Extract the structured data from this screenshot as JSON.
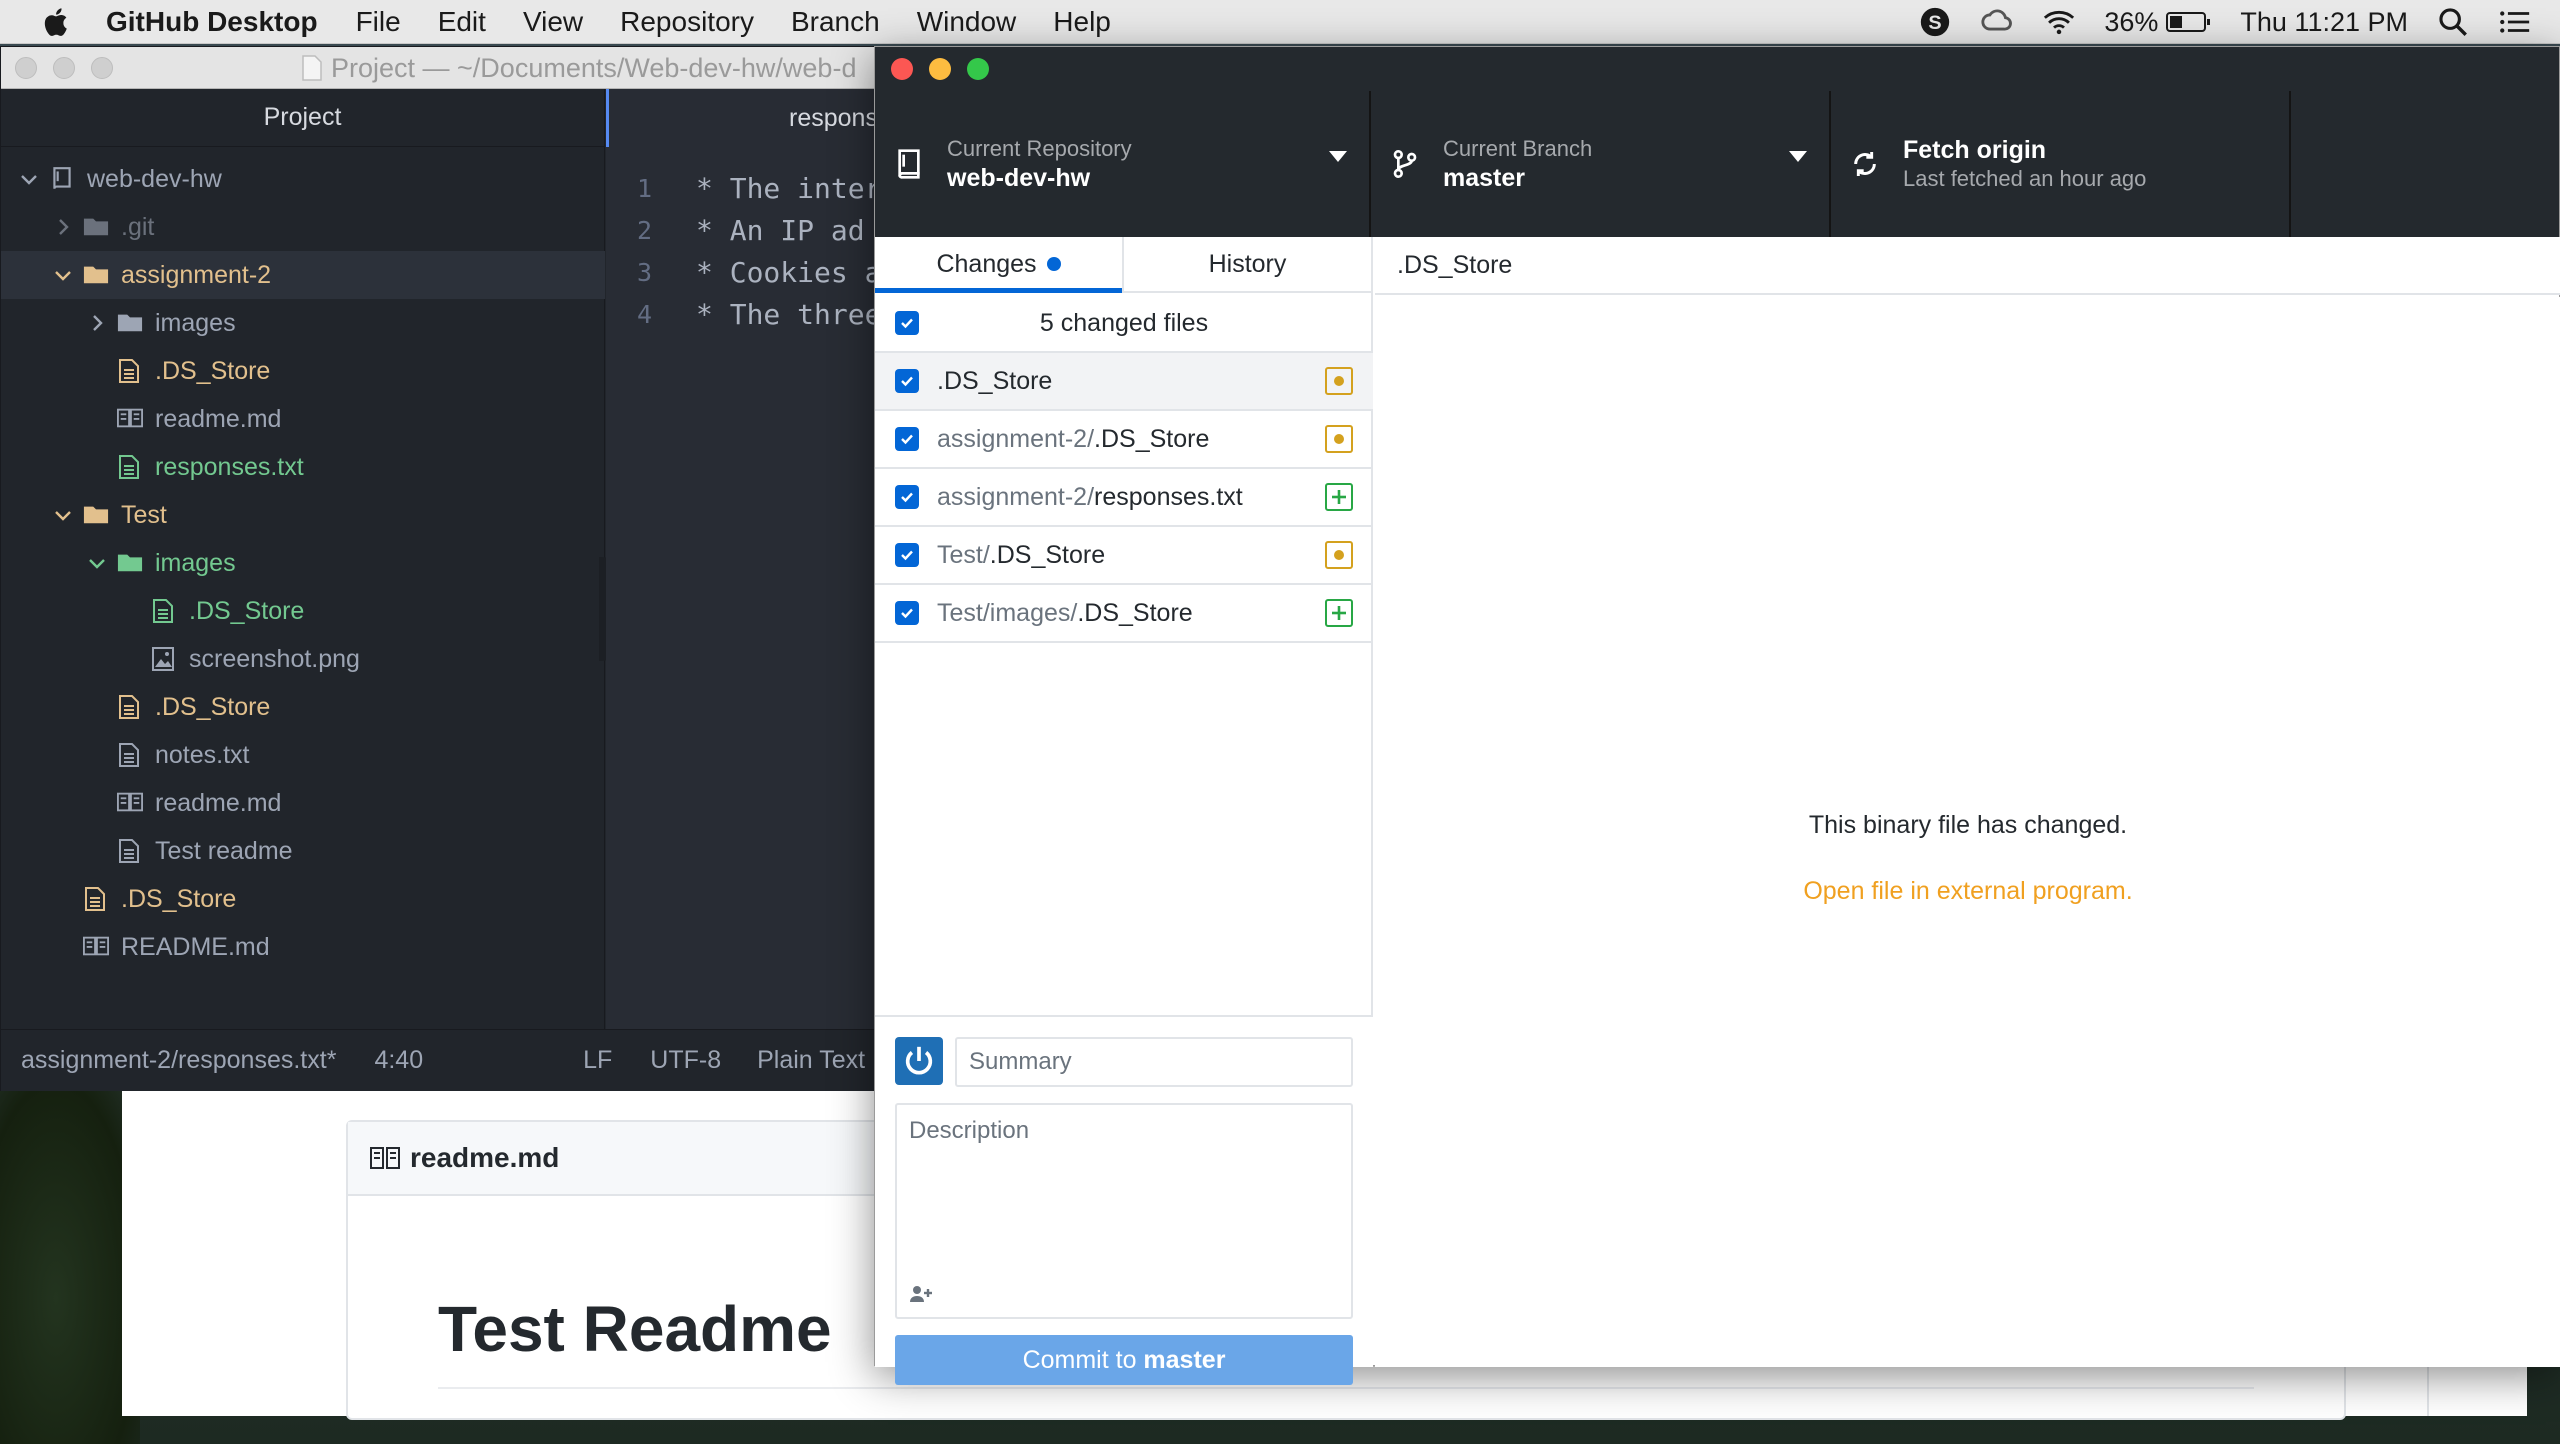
{
  "menubar": {
    "app_name": "GitHub Desktop",
    "menus": [
      "File",
      "Edit",
      "View",
      "Repository",
      "Branch",
      "Window",
      "Help"
    ],
    "battery": "36%",
    "clock": "Thu 11:21 PM"
  },
  "browser": {
    "readme_filename": "readme.md",
    "readme_heading": "Test Readme"
  },
  "atom": {
    "window_title": "Project — ~/Documents/Web-dev-hw/web-d",
    "tree_title": "Project",
    "tree": [
      {
        "label": "web-dev-hw",
        "kind": "repo",
        "depth": 0,
        "expanded": true
      },
      {
        "label": ".git",
        "kind": "folder",
        "depth": 1,
        "expanded": false,
        "status": "dim"
      },
      {
        "label": "assignment-2",
        "kind": "folder",
        "depth": 1,
        "expanded": true,
        "status": "modified"
      },
      {
        "label": "images",
        "kind": "folder",
        "depth": 2,
        "expanded": false
      },
      {
        "label": ".DS_Store",
        "kind": "file",
        "depth": 2,
        "status": "modified"
      },
      {
        "label": "readme.md",
        "kind": "book",
        "depth": 2
      },
      {
        "label": "responses.txt",
        "kind": "file",
        "depth": 2,
        "status": "added"
      },
      {
        "label": "Test",
        "kind": "folder",
        "depth": 1,
        "expanded": true,
        "status": "modified"
      },
      {
        "label": "images",
        "kind": "folder",
        "depth": 2,
        "expanded": true,
        "status": "added"
      },
      {
        "label": ".DS_Store",
        "kind": "file",
        "depth": 3,
        "status": "added"
      },
      {
        "label": "screenshot.png",
        "kind": "image",
        "depth": 3
      },
      {
        "label": ".DS_Store",
        "kind": "file",
        "depth": 2,
        "status": "modified"
      },
      {
        "label": "notes.txt",
        "kind": "file",
        "depth": 2
      },
      {
        "label": "readme.md",
        "kind": "book",
        "depth": 2
      },
      {
        "label": "Test readme",
        "kind": "file",
        "depth": 2
      },
      {
        "label": ".DS_Store",
        "kind": "file",
        "depth": 1,
        "status": "modified"
      },
      {
        "label": "README.md",
        "kind": "book",
        "depth": 1
      }
    ],
    "editor_tab": "respons",
    "code_lines": [
      {
        "n": "1",
        "text": "* The inter"
      },
      {
        "n": "2",
        "text": "*  An IP ad"
      },
      {
        "n": "3",
        "text": "* Cookies a"
      },
      {
        "n": "4",
        "text": "* The three"
      }
    ],
    "status": {
      "file": "assignment-2/responses.txt*",
      "cursor": "4:40",
      "line_ending": "LF",
      "encoding": "UTF-8",
      "grammar": "Plain Text"
    }
  },
  "ghd": {
    "toolbar": {
      "repo_label": "Current Repository",
      "repo_value": "web-dev-hw",
      "branch_label": "Current Branch",
      "branch_value": "master",
      "fetch_label": "Fetch origin",
      "fetch_sub": "Last fetched an hour ago"
    },
    "tabs": {
      "changes": "Changes",
      "history": "History"
    },
    "changed_count": "5 changed files",
    "files": [
      {
        "dir": "",
        "name": ".DS_Store",
        "status": "modified"
      },
      {
        "dir": "assignment-2/",
        "name": ".DS_Store",
        "status": "modified"
      },
      {
        "dir": "assignment-2/",
        "name": "responses.txt",
        "status": "added"
      },
      {
        "dir": "Test/",
        "name": ".DS_Store",
        "status": "modified"
      },
      {
        "dir": "Test/images/",
        "name": ".DS_Store",
        "status": "added"
      }
    ],
    "summary_placeholder": "Summary",
    "description_placeholder": "Description",
    "commit_prefix": "Commit to ",
    "commit_branch": "master",
    "diff_file": ".DS_Store",
    "binary_message": "This binary file has changed.",
    "open_external": "Open file in external program."
  },
  "colors": {
    "accent_blue": "#0366d6",
    "modified": "#d4a11e",
    "added": "#28a745",
    "link_orange": "#f0a020"
  }
}
